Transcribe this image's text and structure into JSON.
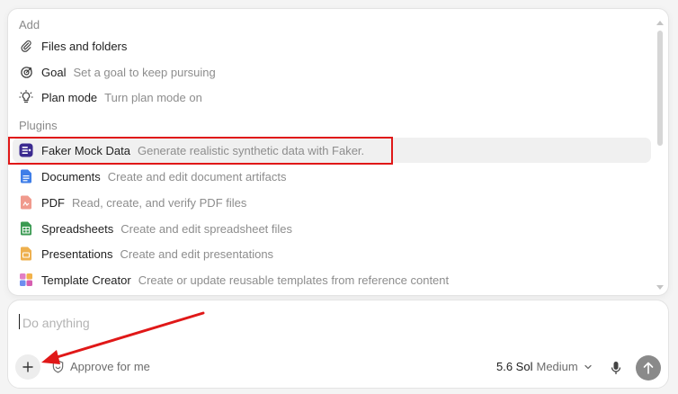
{
  "menu": {
    "add_label": "Add",
    "add_items": [
      {
        "name": "Files and folders",
        "desc": "",
        "icon": "paperclip-icon"
      },
      {
        "name": "Goal",
        "desc": "Set a goal to keep pursuing",
        "icon": "goal-icon"
      },
      {
        "name": "Plan mode",
        "desc": "Turn plan mode on",
        "icon": "lightbulb-icon"
      }
    ],
    "plugins_label": "Plugins",
    "plugin_items": [
      {
        "name": "Faker Mock Data",
        "desc": "Generate realistic synthetic data with Faker.",
        "icon": "faker-icon",
        "color": "#3b2a8f"
      },
      {
        "name": "Documents",
        "desc": "Create and edit document artifacts",
        "icon": "document-icon",
        "color": "#3f7ee8"
      },
      {
        "name": "PDF",
        "desc": "Read, create, and verify PDF files",
        "icon": "pdf-icon",
        "color": "#e8776a"
      },
      {
        "name": "Spreadsheets",
        "desc": "Create and edit spreadsheet files",
        "icon": "spreadsheet-icon",
        "color": "#3a9a52"
      },
      {
        "name": "Presentations",
        "desc": "Create and edit presentations",
        "icon": "presentation-icon",
        "color": "#e8a63a"
      },
      {
        "name": "Template Creator",
        "desc": "Create or update reusable templates from reference content",
        "icon": "template-icon",
        "color": "#d65fb0"
      }
    ]
  },
  "composer": {
    "placeholder": "Do anything",
    "approve_label": "Approve for me",
    "model_name": "5.6 Sol",
    "model_effort": "Medium"
  },
  "colors": {
    "highlight": "#e01818",
    "send_button": "#8a8a8a"
  }
}
